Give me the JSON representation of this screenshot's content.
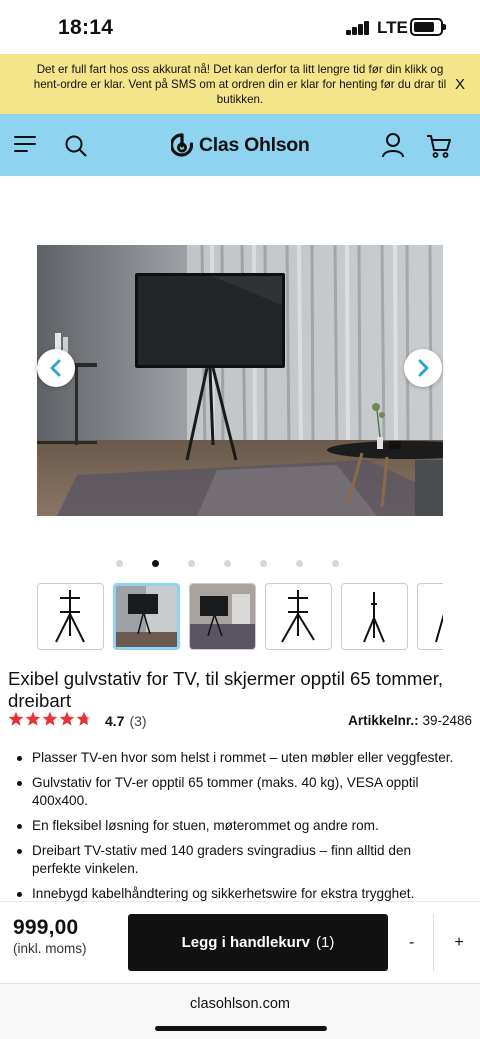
{
  "status_bar": {
    "time": "18:14",
    "network": "LTE"
  },
  "banner": {
    "message": "Det er full fart hos oss akkurat nå! Det kan derfor ta litt lengre tid før din klikk og hent-ordre er klar. Vent på SMS om at ordren din er klar for henting før du drar til butikken.",
    "close_label": "X"
  },
  "header": {
    "logo_text": "Clas Ohlson",
    "menu_icon": "hamburger-menu-icon",
    "search_icon": "search-icon",
    "account_icon": "user-icon",
    "cart_icon": "cart-icon",
    "accent_color": "#8ed3f0"
  },
  "gallery": {
    "image_count": 7,
    "active_index": 1,
    "thumbnail_count": 6,
    "active_thumbnail": 1,
    "prev_icon": "chevron-left-icon",
    "next_icon": "chevron-right-icon"
  },
  "product": {
    "title": "Exibel gulvstativ for TV, til skjermer opptil 65 tommer, dreibart",
    "rating_value": "4.7",
    "rating_stars": 4.7,
    "review_count": "(3)",
    "article_label": "Artikkelnr.:",
    "article_number": "39-2486",
    "features": [
      "Plasser TV-en hvor som helst i rommet – uten møbler eller veggfester.",
      "Gulvstativ for TV-er opptil 65 tommer (maks. 40 kg), VESA opptil 400x400.",
      "En fleksibel løsning for stuen, møterommet og andre rom.",
      "Dreibart TV-stativ med 140 graders svingradius – finn alltid den perfekte vinkelen.",
      "Innebygd kabelhåndtering og sikkerhetswire for ekstra trygghet."
    ]
  },
  "buy_bar": {
    "price": "999,00",
    "vat_note": "(inkl. moms)",
    "add_to_cart_label": "Legg i handlekurv",
    "cart_quantity": "(1)",
    "minus_label": "-",
    "plus_label": "+"
  },
  "browser": {
    "url": "clasohlson.com"
  }
}
